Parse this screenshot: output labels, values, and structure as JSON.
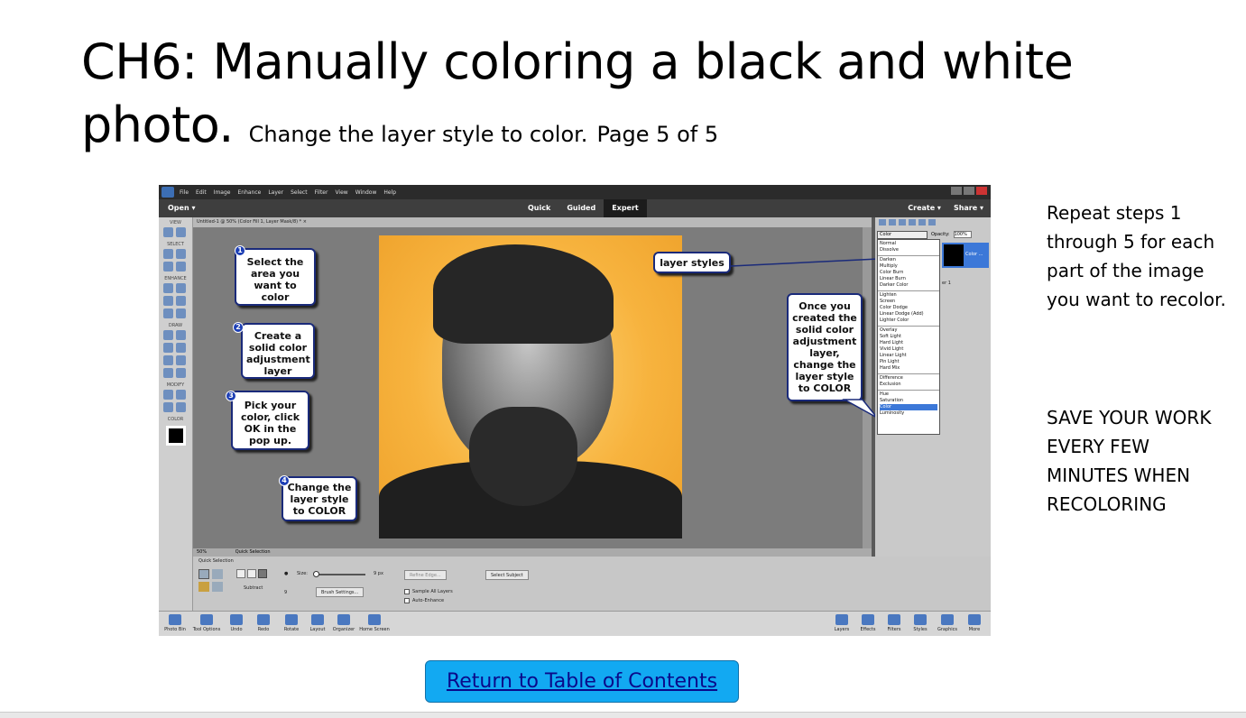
{
  "slide": {
    "title_line1": "CH6: Manually coloring a black and white",
    "title_line2": "photo.",
    "subtitle": "Change the layer style to color.",
    "page_label": "Page 5 of 5",
    "side_note_1": "Repeat steps 1 through 5 for each part of the image you want to recolor.",
    "side_note_2": "SAVE YOUR WORK EVERY FEW MINUTES WHEN RECOLORING",
    "toc_link": "Return to Table of Contents"
  },
  "editor": {
    "menu": [
      "File",
      "Edit",
      "Image",
      "Enhance",
      "Layer",
      "Select",
      "Filter",
      "View",
      "Window",
      "Help"
    ],
    "open_label": "Open",
    "modes": [
      "Quick",
      "Guided",
      "Expert"
    ],
    "active_mode": "Expert",
    "create_label": "Create",
    "share_label": "Share",
    "doc_tab": "Untitled-1 @ 50% (Color Fill 1, Layer Mask/8) *",
    "tool_groups": [
      "VIEW",
      "SELECT",
      "ENHANCE",
      "DRAW",
      "MODIFY",
      "COLOR"
    ],
    "zoom": "50%",
    "tool_name": "Quick Selection",
    "options": {
      "title": "Quick Selection",
      "subtract": "Subtract",
      "size_label": "Size:",
      "size_value": "9 px",
      "brush_num": "9",
      "refine_edge": "Refine Edge...",
      "select_subject": "Select Subject",
      "brush_settings": "Brush Settings...",
      "sample_all": "Sample All Layers",
      "auto_enhance": "Auto-Enhance"
    },
    "blend": {
      "selected": "Color",
      "opacity_label": "Opacity:",
      "opacity_value": "100%",
      "groups": [
        [
          "Normal",
          "Dissolve"
        ],
        [
          "Darken",
          "Multiply",
          "Color Burn",
          "Linear Burn",
          "Darker Color"
        ],
        [
          "Lighten",
          "Screen",
          "Color Dodge",
          "Linear Dodge (Add)",
          "Lighter Color"
        ],
        [
          "Overlay",
          "Soft Light",
          "Hard Light",
          "Vivid Light",
          "Linear Light",
          "Pin Light",
          "Hard Mix"
        ],
        [
          "Difference",
          "Exclusion"
        ],
        [
          "Hue",
          "Saturation",
          "Color",
          "Luminosity"
        ]
      ]
    },
    "layer_label": "Color ...",
    "layer1_label": "er 1",
    "callouts": {
      "c1": "Select the area you want to color",
      "c2": "Create a solid color adjustment layer",
      "c3": "Pick your color, click OK in the pop up.",
      "c4": "Change the layer style to COLOR",
      "layer_styles": "layer styles",
      "once": "Once you created the solid color adjustment layer, change the layer style to COLOR"
    },
    "numbers": [
      "1",
      "2",
      "3",
      "4"
    ],
    "bottom_left": [
      "Photo Bin",
      "Tool Options",
      "Undo",
      "Redo",
      "Rotate",
      "Layout",
      "Organizer",
      "Home Screen"
    ],
    "bottom_right": [
      "Layers",
      "Effects",
      "Filters",
      "Styles",
      "Graphics",
      "More"
    ]
  }
}
